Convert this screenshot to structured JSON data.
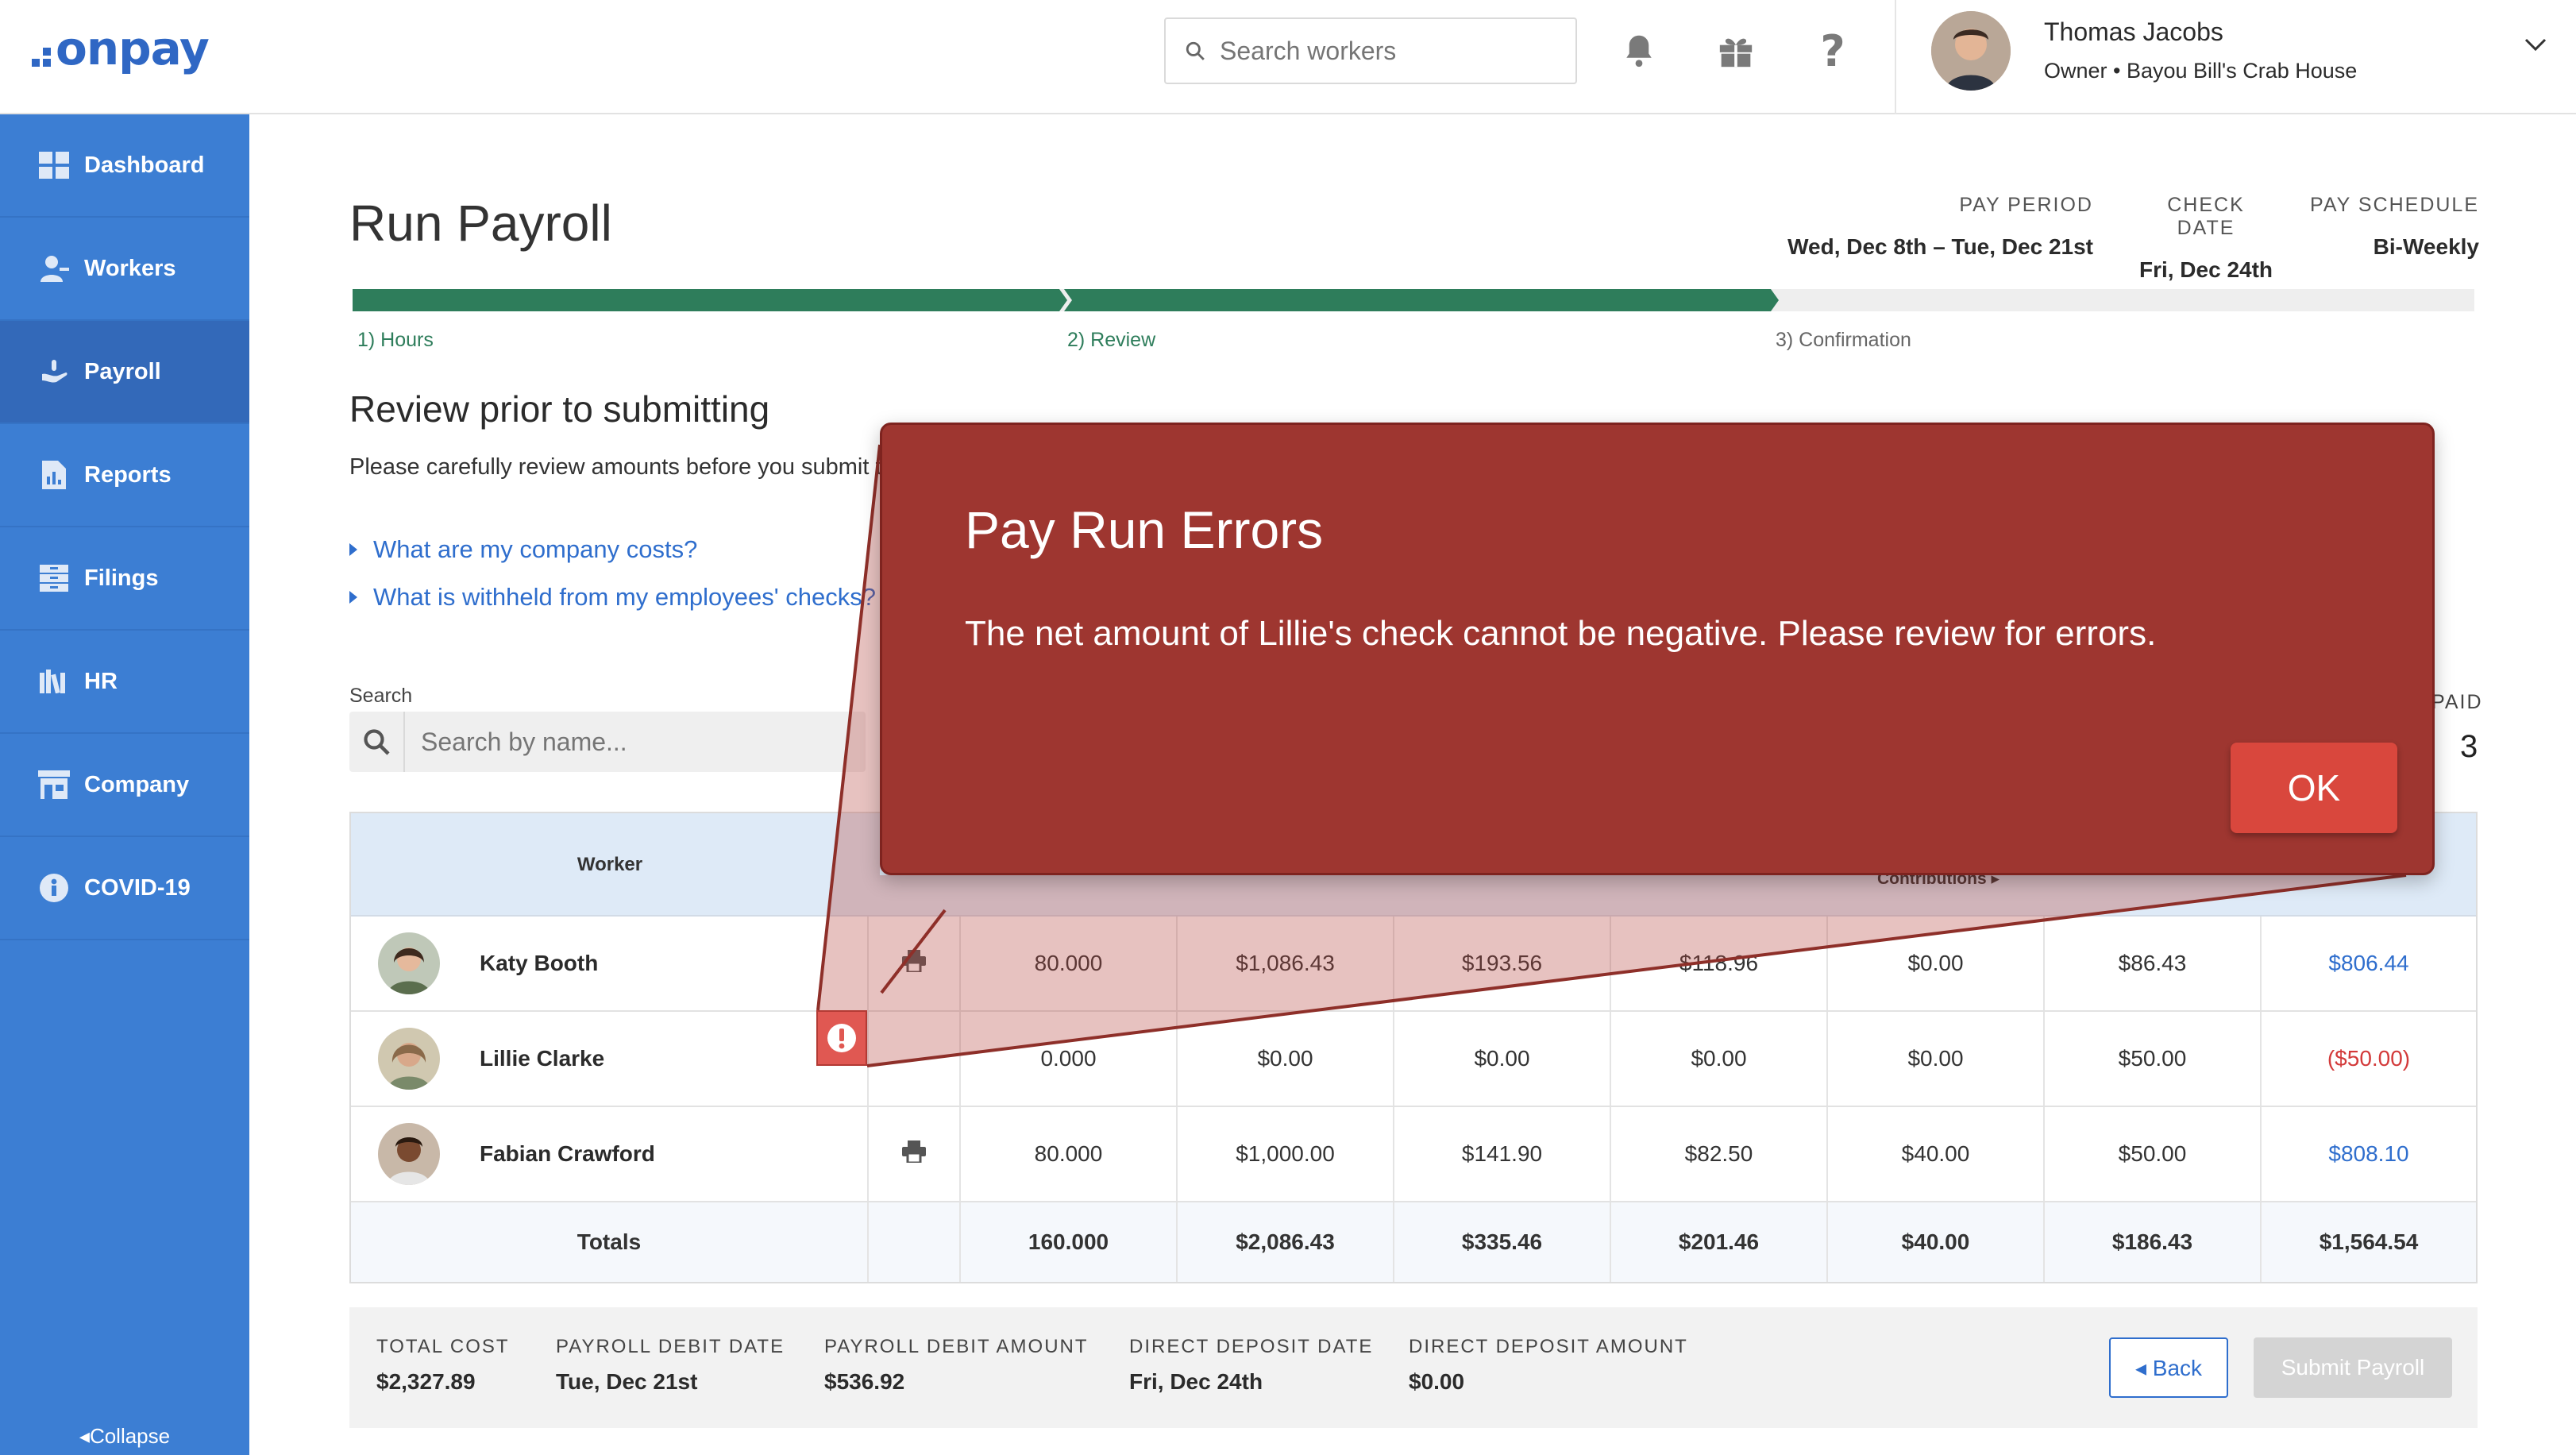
{
  "app": {
    "logo_text": "onpay",
    "search_placeholder": "Search workers",
    "user_name": "Thomas Jacobs",
    "user_role": "Owner • Bayou Bill's Crab House"
  },
  "sidebar": {
    "items": [
      {
        "label": "Dashboard",
        "icon": "dashboard-icon"
      },
      {
        "label": "Workers",
        "icon": "workers-icon"
      },
      {
        "label": "Payroll",
        "icon": "payroll-icon",
        "active": true
      },
      {
        "label": "Reports",
        "icon": "reports-icon"
      },
      {
        "label": "Filings",
        "icon": "filings-icon"
      },
      {
        "label": "HR",
        "icon": "hr-icon"
      },
      {
        "label": "Company",
        "icon": "company-icon"
      },
      {
        "label": "COVID-19",
        "icon": "info-icon"
      }
    ],
    "collapse_label": "Collapse"
  },
  "page": {
    "title": "Run Payroll",
    "pay_period_label": "PAY PERIOD",
    "pay_period_value": "Wed, Dec 8th – Tue, Dec 21st",
    "check_date_label": "CHECK DATE",
    "check_date_value": "Fri, Dec 24th",
    "pay_schedule_label": "PAY SCHEDULE",
    "pay_schedule_value": "Bi-Weekly"
  },
  "steps": [
    {
      "label": "1) Hours",
      "state": "complete"
    },
    {
      "label": "2) Review",
      "state": "current"
    },
    {
      "label": "3) Confirmation",
      "state": "pending"
    }
  ],
  "review": {
    "title": "Review prior to submitting",
    "subtitle": "Please carefully review amounts before you submit th",
    "faq_costs": "What are my company costs?",
    "faq_withheld": "What is withheld from my employees' checks?",
    "search_label": "Search",
    "search_placeholder": "Search by name...",
    "paid_label": "PAID",
    "paid_value": "3"
  },
  "table": {
    "worker_header": "Worker",
    "contributions_header": "Contributions ▸",
    "rows": [
      {
        "name": "Katy Booth",
        "print": true,
        "hours": "80.000",
        "gross": "$1,086.43",
        "c3": "$193.56",
        "c4": "$118.96",
        "c5": "$0.00",
        "c6": "$86.43",
        "net": "$806.44",
        "net_color": "#2f6ecd"
      },
      {
        "name": "Lillie Clarke",
        "print": false,
        "hours": "0.000",
        "gross": "$0.00",
        "c3": "$0.00",
        "c4": "$0.00",
        "c5": "$0.00",
        "c6": "$50.00",
        "net": "($50.00)",
        "net_color": "#d33a3a"
      },
      {
        "name": "Fabian Crawford",
        "print": true,
        "hours": "80.000",
        "gross": "$1,000.00",
        "c3": "$141.90",
        "c4": "$82.50",
        "c5": "$40.00",
        "c6": "$50.00",
        "net": "$808.10",
        "net_color": "#2f6ecd"
      }
    ],
    "totals": {
      "label": "Totals",
      "hours": "160.000",
      "gross": "$2,086.43",
      "c3": "$335.46",
      "c4": "$201.46",
      "c5": "$40.00",
      "c6": "$186.43",
      "net": "$1,564.54"
    }
  },
  "summary": {
    "total_cost_label": "TOTAL COST",
    "total_cost_value": "$2,327.89",
    "debit_date_label": "PAYROLL DEBIT DATE",
    "debit_date_value": "Tue, Dec 21st",
    "debit_amount_label": "PAYROLL DEBIT AMOUNT",
    "debit_amount_value": "$536.92",
    "dd_date_label": "DIRECT DEPOSIT DATE",
    "dd_date_value": "Fri, Dec 24th",
    "dd_amount_label": "DIRECT DEPOSIT AMOUNT",
    "dd_amount_value": "$0.00",
    "back_label": "◂ Back",
    "submit_label": "Submit Payroll"
  },
  "modal": {
    "title": "Pay Run Errors",
    "message": "The net amount of Lillie's check cannot be negative. Please review for errors.",
    "ok_label": "OK"
  },
  "colors": {
    "brand_blue": "#3c7ed3",
    "progress_green": "#2e7d5b",
    "error_red": "#9e3630",
    "link_blue": "#2f6ecd"
  }
}
